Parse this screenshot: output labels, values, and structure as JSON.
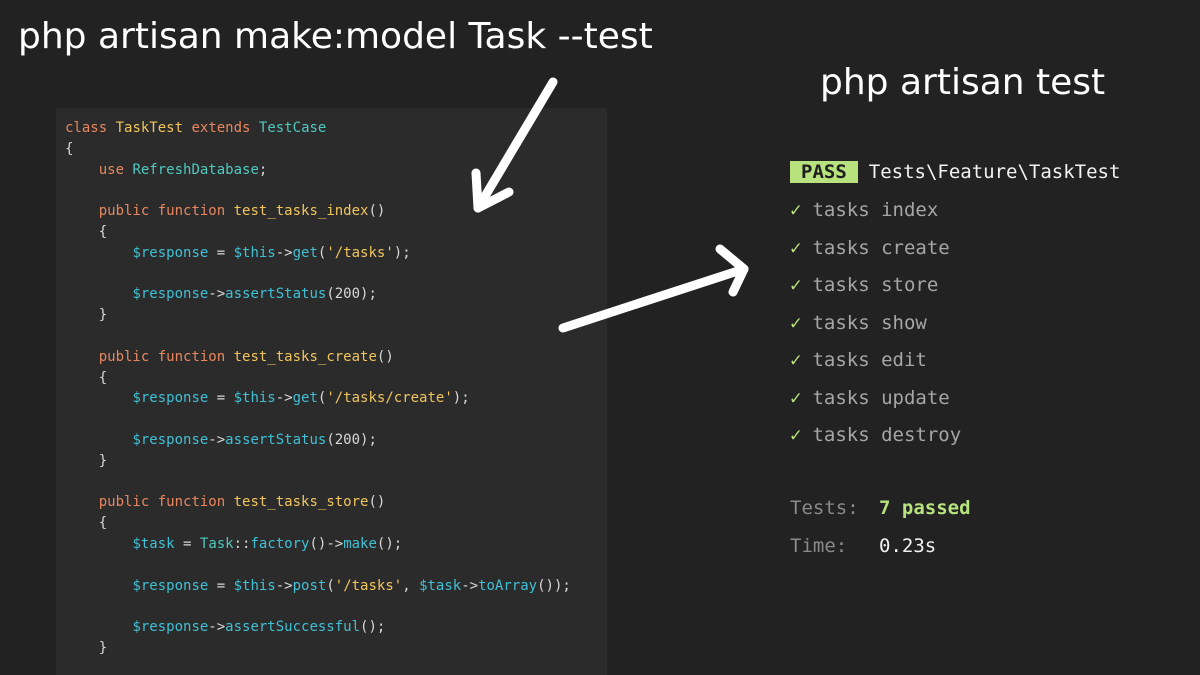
{
  "headings": {
    "make_command": "php artisan make:model Task --test",
    "test_command": "php artisan test"
  },
  "code": {
    "class_kw": "class",
    "class_name": "TaskTest",
    "extends_kw": "extends",
    "parent": "TestCase",
    "open_brace": "{",
    "use_kw": "use",
    "use_trait": "RefreshDatabase",
    "semicolon": ";",
    "public_kw": "public",
    "function_kw": "function",
    "method_index": "test_tasks_index",
    "method_create": "test_tasks_create",
    "method_store": "test_tasks_store",
    "parens": "()",
    "brace_open": "{",
    "brace_close": "}",
    "response_var": "$response",
    "task_var": "$task",
    "assign": " = ",
    "this_var": "$this",
    "arrow": "->",
    "get_fn": "get",
    "post_fn": "post",
    "assert_status": "assertStatus",
    "assert_successful": "assertSuccessful",
    "status_arg": "(200);",
    "str_tasks": "'/tasks'",
    "str_tasks_create": "'/tasks/create'",
    "close_call": ");",
    "open_paren": "(",
    "task_class": "Task",
    "scope_op": "::",
    "factory_fn": "factory",
    "make_fn": "make",
    "empty_call": "()",
    "end_call": "();",
    "comma": ", ",
    "to_array_fn": "toArray",
    "end_double_call": "());"
  },
  "results": {
    "badge": "PASS",
    "test_class": "Tests\\Feature\\TaskTest",
    "check_glyph": "✓",
    "tests": [
      "tasks index",
      "tasks create",
      "tasks store",
      "tasks show",
      "tasks edit",
      "tasks update",
      "tasks destroy"
    ],
    "tests_label": "Tests:",
    "tests_value": "7 passed",
    "time_label": "Time:",
    "time_value": "0.23s"
  },
  "colors": {
    "background": "#222222",
    "code_panel": "#2b2b2b",
    "pass_green": "#b7e27e",
    "keyword": "#e8875f",
    "identifier": "#f2c55c",
    "variable": "#3fc0d5",
    "type": "#4ec9c0"
  }
}
